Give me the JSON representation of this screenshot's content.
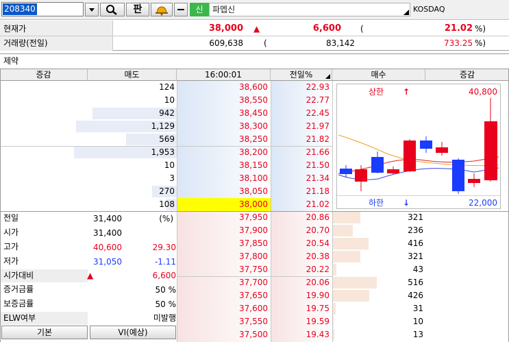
{
  "toolbar": {
    "code": "208340",
    "name": "파멥신",
    "tag": "신",
    "market": "KOSDAQ",
    "pan_label": "판"
  },
  "summary": {
    "price_label": "현재가",
    "price": "38,000",
    "change_arrow": "▲",
    "change": "6,600",
    "paren_open": "(",
    "change_pct": "21.02",
    "pct_suffix": "%)",
    "volume_label": "거래량(전일)",
    "volume": "609,638",
    "volume_paren": "(",
    "prev_volume": "83,142",
    "volume_ratio": "733.25",
    "ratio_suffix": "%)"
  },
  "contract_label": "제약",
  "table_header": {
    "ask_change": "증감",
    "ask": "매도",
    "time": "16:00:01",
    "prev_pct": "전일%",
    "bid": "매수",
    "bid_change": "증감"
  },
  "asks": [
    {
      "qty": "124",
      "price": "38,600",
      "pct": "22.93",
      "bar": 0.0
    },
    {
      "qty": "10",
      "price": "38,550",
      "pct": "22.77",
      "bar": 0.0
    },
    {
      "qty": "942",
      "price": "38,450",
      "pct": "22.45",
      "bar": 0.82
    },
    {
      "qty": "1,129",
      "price": "38,300",
      "pct": "21.97",
      "bar": 0.98
    },
    {
      "qty": "569",
      "price": "38,250",
      "pct": "21.82",
      "bar": 0.49
    },
    {
      "qty": "1,953",
      "price": "38,200",
      "pct": "21.66",
      "bar": 1.0
    },
    {
      "qty": "10",
      "price": "38,150",
      "pct": "21.50",
      "bar": 0.0
    },
    {
      "qty": "3",
      "price": "38,100",
      "pct": "21.34",
      "bar": 0.0
    },
    {
      "qty": "270",
      "price": "38,050",
      "pct": "21.18",
      "bar": 0.24
    },
    {
      "qty": "108",
      "price": "38,000",
      "pct": "21.02",
      "bar": 0.1
    }
  ],
  "bids": [
    {
      "price": "37,950",
      "pct": "20.86",
      "qty": "321",
      "bar": 0.62
    },
    {
      "price": "37,900",
      "pct": "20.70",
      "qty": "236",
      "bar": 0.46
    },
    {
      "price": "37,850",
      "pct": "20.54",
      "qty": "416",
      "bar": 0.81
    },
    {
      "price": "37,800",
      "pct": "20.38",
      "qty": "321",
      "bar": 0.62
    },
    {
      "price": "37,750",
      "pct": "20.22",
      "qty": "43",
      "bar": 0.08
    },
    {
      "price": "37,700",
      "pct": "20.06",
      "qty": "516",
      "bar": 1.0
    },
    {
      "price": "37,650",
      "pct": "19.90",
      "qty": "426",
      "bar": 0.83
    },
    {
      "price": "37,600",
      "pct": "19.75",
      "qty": "31",
      "bar": 0.06
    },
    {
      "price": "37,550",
      "pct": "19.59",
      "qty": "10",
      "bar": 0.02
    },
    {
      "price": "37,500",
      "pct": "19.43",
      "qty": "13",
      "bar": 0.03
    }
  ],
  "info": {
    "prev_label": "전일",
    "prev_value": "31,400",
    "prev_unit": "(%)",
    "open_label": "시가",
    "open_value": "31,400",
    "high_label": "고가",
    "high_value": "40,600",
    "high_pct": "29.30",
    "low_label": "저가",
    "low_value": "31,050",
    "low_pct": "-1.11",
    "open_diff_label": "시가대비",
    "open_diff_arrow": "▲",
    "open_diff_value": "6,600",
    "margin_label": "증거금률",
    "margin_value": "50 %",
    "deposit_label": "보증금률",
    "deposit_value": "50 %",
    "elw_label": "ELW여부",
    "elw_value": "미발행"
  },
  "bottom_buttons": {
    "basic": "기본",
    "vi": "VI(예상)"
  },
  "mini_chart": {
    "upper_label": "상한",
    "upper_arrow": "↑",
    "upper_value": "40,800",
    "lower_label": "하한",
    "lower_arrow": "↓",
    "lower_value": "22,000",
    "up_color": "#e8001c",
    "down_color": "#1a3cff"
  },
  "colors": {
    "accent_green": "#3cb84a",
    "highlight_yellow": "#ffff00",
    "up": "#e8001c",
    "down": "#1a3cff"
  },
  "icons": [
    "dropdown-arrow-icon",
    "search-icon",
    "bell-icon",
    "dropdown-arrow-icon"
  ]
}
